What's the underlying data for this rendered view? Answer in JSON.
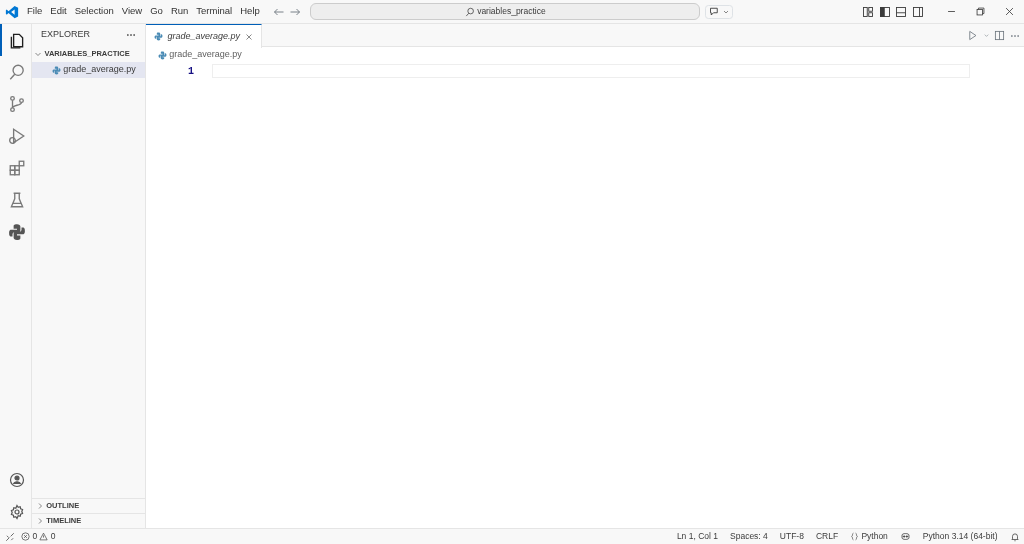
{
  "menu": [
    "File",
    "Edit",
    "Selection",
    "View",
    "Go",
    "Run",
    "Terminal",
    "Help"
  ],
  "command_center": {
    "text": "variables_practice"
  },
  "activity_bar": [
    {
      "kind": "files",
      "selected": true
    },
    {
      "kind": "search",
      "selected": false
    },
    {
      "kind": "branch",
      "selected": false
    },
    {
      "kind": "debug",
      "selected": false
    },
    {
      "kind": "extensions",
      "selected": false
    },
    {
      "kind": "flask",
      "selected": false
    },
    {
      "kind": "python",
      "selected": false
    }
  ],
  "explorer": {
    "title": "EXPLORER",
    "folder": {
      "name": "VARIABLES_PRACTICE",
      "expanded": true,
      "files": [
        {
          "name": "grade_average.py",
          "selected": true
        }
      ]
    },
    "sections": [
      {
        "label": "OUTLINE",
        "expanded": false
      },
      {
        "label": "TIMELINE",
        "expanded": false
      }
    ]
  },
  "tabs": [
    {
      "label": "grade_average.py",
      "selected": true,
      "preview": true
    }
  ],
  "breadcrumb": "grade_average.py",
  "line_numbers": [
    "1"
  ],
  "status_bar": {
    "errors": "0",
    "warnings": "0",
    "items": [
      "Ln 1, Col 1",
      "Spaces: 4",
      "UTF-8",
      "CRLF",
      "Python",
      "Python 3.14 (64-bit)"
    ]
  }
}
